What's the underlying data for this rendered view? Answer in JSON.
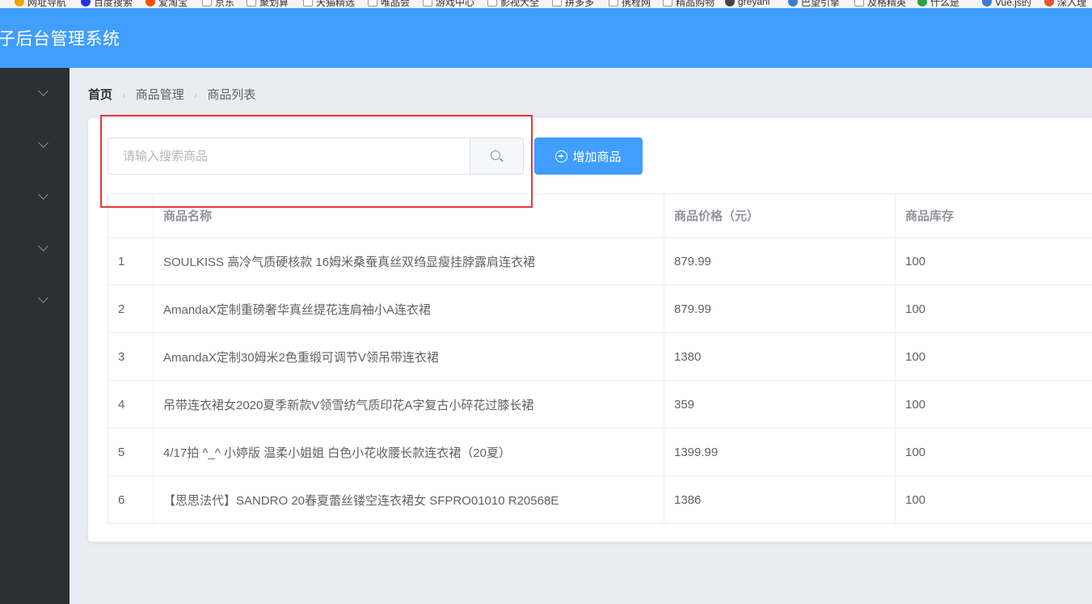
{
  "bookmarks": [
    {
      "label": "网址导航",
      "icon": "globe-icon",
      "color": "#f0a500"
    },
    {
      "label": "百度搜索",
      "icon": "baidu-icon",
      "color": "#2932e1"
    },
    {
      "label": "爱淘宝",
      "icon": "taobao-icon",
      "color": "#ff5000"
    },
    {
      "label": "京东",
      "icon": "page-icon",
      "color": "#999999"
    },
    {
      "label": "聚划算",
      "icon": "page-icon",
      "color": "#999999"
    },
    {
      "label": "天猫精选",
      "icon": "page-icon",
      "color": "#999999"
    },
    {
      "label": "唯品会",
      "icon": "page-icon",
      "color": "#999999"
    },
    {
      "label": "游戏中心",
      "icon": "page-icon",
      "color": "#999999"
    },
    {
      "label": "影视大全",
      "icon": "page-icon",
      "color": "#999999"
    },
    {
      "label": "拼多多",
      "icon": "page-icon",
      "color": "#999999"
    },
    {
      "label": "携程网",
      "icon": "page-icon",
      "color": "#999999"
    },
    {
      "label": "精品购物",
      "icon": "page-icon",
      "color": "#999999"
    },
    {
      "label": "greyani",
      "icon": "wolf-icon",
      "color": "#444444"
    },
    {
      "label": "巴望引擎",
      "icon": "gear-icon",
      "color": "#3a7bd5"
    },
    {
      "label": "及格精英",
      "icon": "page-icon",
      "color": "#999999"
    },
    {
      "label": "什么是",
      "icon": "green-icon",
      "color": "#2e9e44"
    },
    {
      "label": "Vue.js的",
      "icon": "vue-icon",
      "color": "#3a7bd5"
    },
    {
      "label": "深入理",
      "icon": "c-icon",
      "color": "#e8542e"
    }
  ],
  "header": {
    "title": "子后台管理系统"
  },
  "sidebar": {
    "item_count": 5
  },
  "breadcrumb": {
    "home": "首页",
    "level1": "商品管理",
    "level2": "商品列表"
  },
  "search": {
    "placeholder": "请输入搜索商品",
    "value": ""
  },
  "toolbar": {
    "add_label": "增加商品"
  },
  "table": {
    "headers": {
      "index": "",
      "name": "商品名称",
      "price": "商品价格（元）",
      "stock": "商品库存"
    },
    "rows": [
      {
        "index": "1",
        "name": "SOULKISS 高冷气质硬核款 16姆米桑蚕真丝双绉显瘦挂脖露肩连衣裙",
        "price": "879.99",
        "stock": "100"
      },
      {
        "index": "2",
        "name": "AmandaX定制重磅奢华真丝提花连肩袖小A连衣裙",
        "price": "879.99",
        "stock": "100"
      },
      {
        "index": "3",
        "name": "AmandaX定制30姆米2色重缎可调节V领吊带连衣裙",
        "price": "1380",
        "stock": "100"
      },
      {
        "index": "4",
        "name": "吊带连衣裙女2020夏季新款V领雪纺气质印花A字复古小碎花过膝长裙",
        "price": "359",
        "stock": "100"
      },
      {
        "index": "5",
        "name": "4/17拍 ^_^ 小婷版 温柔小姐姐 白色小花收腰长款连衣裙（20夏）",
        "price": "1399.99",
        "stock": "100"
      },
      {
        "index": "6",
        "name": "【思思法代】SANDRO 20春夏蕾丝镂空连衣裙女 SFPRO01010 R20568E",
        "price": "1386",
        "stock": "100"
      }
    ]
  },
  "colors": {
    "primary": "#409eff",
    "sidebar": "#2d2f33",
    "highlight": "#e53935",
    "background": "#e9edf3"
  }
}
